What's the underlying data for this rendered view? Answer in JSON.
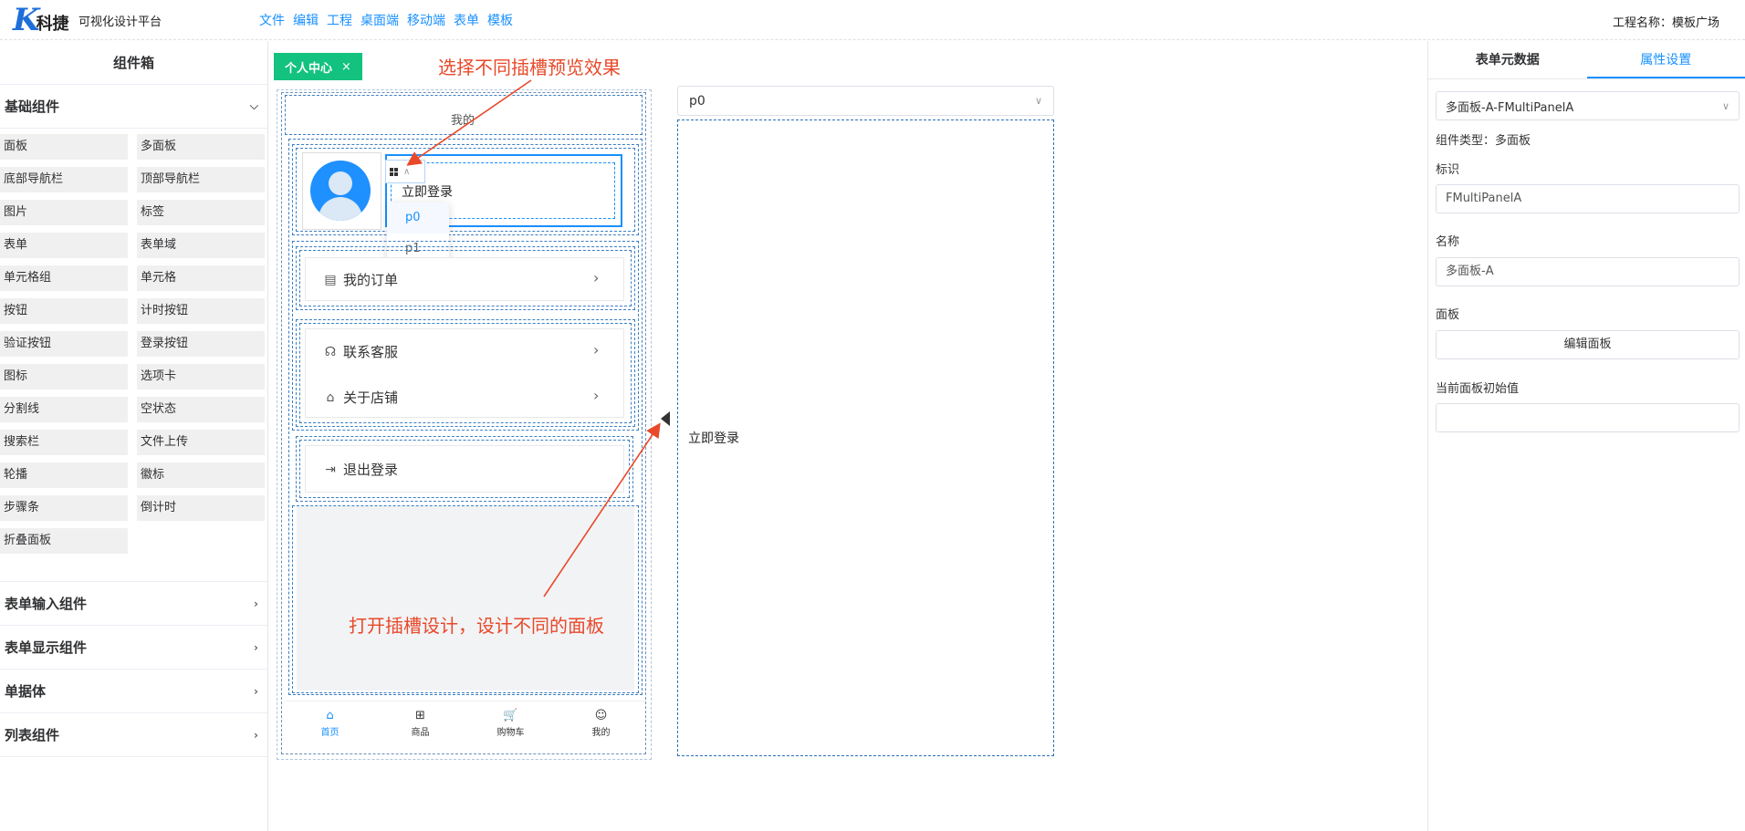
{
  "header": {
    "logo_letter": "K",
    "logo_name": "科捷",
    "platform": "可视化设计平台",
    "menu": [
      "文件",
      "编辑",
      "工程",
      "桌面端",
      "移动端",
      "表单",
      "模板"
    ],
    "project_label": "工程名称：模板广场"
  },
  "left_panel": {
    "title": "组件箱",
    "basic_group": "基础组件",
    "components": [
      "面板",
      "多面板",
      "底部导航栏",
      "顶部导航栏",
      "图片",
      "标签",
      "表单",
      "表单域",
      "单元格组",
      "单元格",
      "按钮",
      "计时按钮",
      "验证按钮",
      "登录按钮",
      "图标",
      "选项卡",
      "分割线",
      "空状态",
      "搜索栏",
      "文件上传",
      "轮播",
      "徽标",
      "步骤条",
      "倒计时",
      "折叠面板"
    ],
    "other_groups": [
      "表单输入组件",
      "表单显示组件",
      "单据体",
      "列表组件"
    ]
  },
  "canvas": {
    "tab_label": "个人中心",
    "tab_close": "×",
    "phone_title": "我的",
    "login_text": "立即登录",
    "slot_options": [
      "p0",
      "p1"
    ],
    "rows": [
      {
        "icon": "▤",
        "label": "我的订单"
      },
      {
        "icon": "☊",
        "label": "联系客服"
      },
      {
        "icon": "⌂",
        "label": "关于店铺"
      },
      {
        "icon": "⇥",
        "label": "退出登录"
      }
    ],
    "tabbar": [
      {
        "icon": "⌂",
        "label": "首页"
      },
      {
        "icon": "⊞",
        "label": "商品"
      },
      {
        "icon": "🛒",
        "label": "购物车"
      },
      {
        "icon": "☺",
        "label": "我的"
      }
    ]
  },
  "slot_panel": {
    "selected": "p0",
    "content_text": "立即登录"
  },
  "annotations": {
    "top": "选择不同插槽预览效果",
    "bottom": "打开插槽设计，设计不同的面板"
  },
  "right_panel": {
    "tabs": [
      "表单元数据",
      "属性设置"
    ],
    "component_select": "多面板-A-FMultiPanelA",
    "component_type": "组件类型：多面板",
    "id_label": "标识",
    "id_value": "FMultiPanelA",
    "name_label": "名称",
    "name_value": "多面板-A",
    "panel_label": "面板",
    "edit_panel_button": "编辑面板",
    "initial_label": "当前面板初始值",
    "initial_value": ""
  },
  "colors": {
    "accent": "#1890ff",
    "tab_green": "#13c27e",
    "annotation_red": "#e8492a"
  }
}
